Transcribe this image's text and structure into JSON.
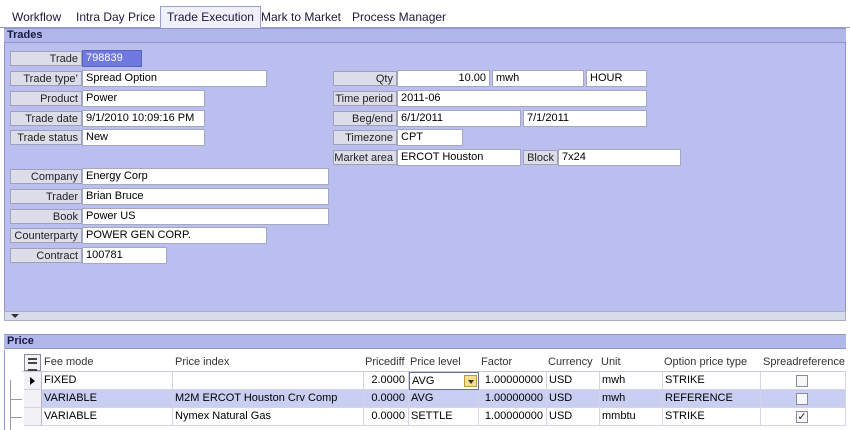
{
  "tabs": [
    {
      "label": "Workflow"
    },
    {
      "label": "Intra Day Price"
    },
    {
      "label": "Trade Execution"
    },
    {
      "label": "Mark to Market"
    },
    {
      "label": "Process Manager"
    }
  ],
  "active_tab": "Trade Execution",
  "trades_title": "Trades",
  "trade": {
    "trade_label": "Trade",
    "trade_value": "798839",
    "trade_type_label": "Trade type’",
    "trade_type_value": "Spread Option",
    "product_label": "Product",
    "product_value": "Power",
    "trade_date_label": "Trade date",
    "trade_date_value": "9/1/2010 10:09:16 PM",
    "trade_status_label": "Trade status",
    "trade_status_value": "New",
    "company_label": "Company",
    "company_value": "Energy Corp",
    "trader_label": "Trader",
    "trader_value": "Brian Bruce",
    "book_label": "Book",
    "book_value": "Power US",
    "counterparty_label": "Counterparty",
    "counterparty_value": "POWER GEN CORP.",
    "contract_label": "Contract",
    "contract_value": "100781",
    "qty_label": "Qty",
    "qty_value": "10.00",
    "qty_unit": "mwh",
    "qty_period": "HOUR",
    "time_period_label": "Time period",
    "time_period_value": "2011-06",
    "beg_end_label": "Beg/end",
    "beg_value": "6/1/2011",
    "end_value": "7/1/2011",
    "timezone_label": "Timezone",
    "timezone_value": "CPT",
    "market_area_label": "Market area",
    "market_area_value": "ERCOT Houston",
    "block_label": "Block",
    "block_value": "7x24"
  },
  "price_title": "Price",
  "price_grid": {
    "columns": [
      "Fee mode",
      "Price index",
      "Pricediff",
      "Price level",
      "Factor",
      "Currency",
      "Unit",
      "Option price type",
      "Spreadreference"
    ],
    "rows": [
      {
        "fee_mode": "FIXED",
        "price_index": "",
        "pricediff": "2.0000",
        "price_level": "AVG",
        "factor": "1.00000000",
        "currency": "USD",
        "unit": "mwh",
        "option_price_type": "STRIKE",
        "spread_reference": false
      },
      {
        "fee_mode": "VARIABLE",
        "price_index": "M2M ERCOT Houston Crv Comp",
        "pricediff": "0.0000",
        "price_level": "AVG",
        "factor": "1.00000000",
        "currency": "USD",
        "unit": "mwh",
        "option_price_type": "REFERENCE",
        "spread_reference": false
      },
      {
        "fee_mode": "VARIABLE",
        "price_index": "Nymex Natural Gas",
        "pricediff": "0.0000",
        "price_level": "SETTLE",
        "factor": "1.00000000",
        "currency": "USD",
        "unit": "mmbtu",
        "option_price_type": "STRIKE",
        "spread_reference": true
      }
    ]
  },
  "colors": {
    "panel_bg": "#babff0",
    "selected_field": "#6f79e0",
    "selected_row": "#c9cef3"
  }
}
